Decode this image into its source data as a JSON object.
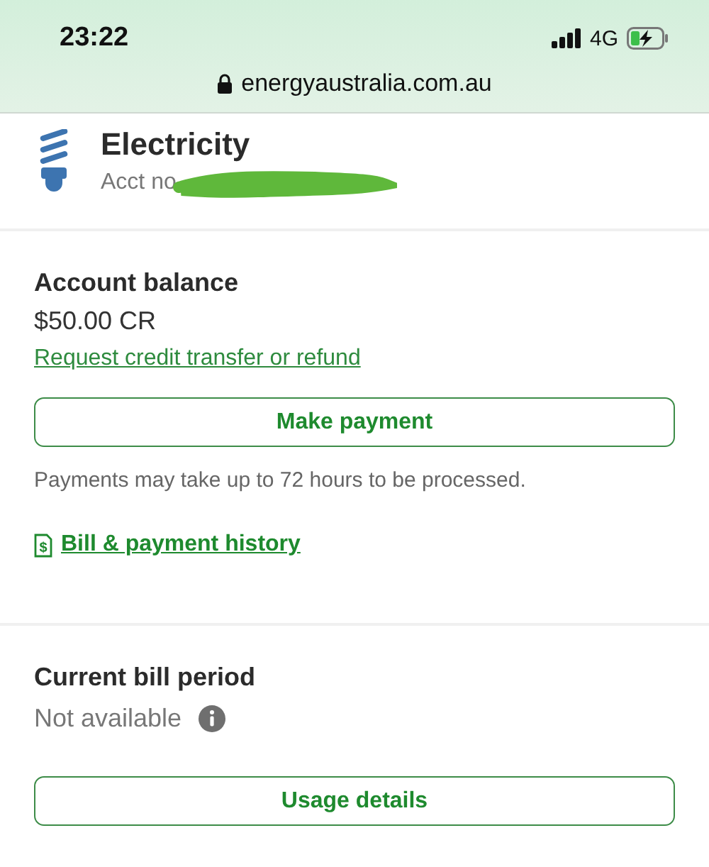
{
  "status_bar": {
    "time": "23:22",
    "network": "4G"
  },
  "address_bar": {
    "url": "energyaustralia.com.au"
  },
  "account": {
    "title": "Electricity",
    "number_label": "Acct no",
    "redacted": true
  },
  "balance": {
    "heading": "Account balance",
    "amount": "$50.00 CR",
    "refund_link": "Request credit transfer or refund",
    "pay_button": "Make payment",
    "note": "Payments may take up to 72 hours to be processed.",
    "history_icon": "$",
    "history_link": "Bill & payment history"
  },
  "bill_period": {
    "heading": "Current bill period",
    "value": "Not available",
    "usage_button": "Usage details"
  }
}
